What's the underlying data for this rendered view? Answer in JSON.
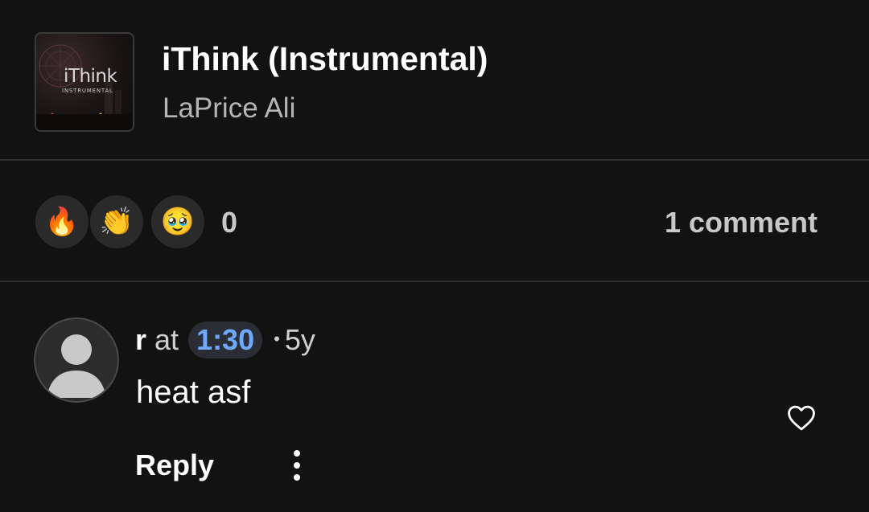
{
  "track": {
    "title": "iThink (Instrumental)",
    "artist": "LaPrice Ali",
    "artwork": {
      "title": "iThink",
      "subtitle": "INSTRUMENTAL"
    }
  },
  "reactions": {
    "items": [
      {
        "name": "fire",
        "emoji": "🔥"
      },
      {
        "name": "clap",
        "emoji": "👏"
      },
      {
        "name": "pleading",
        "emoji": "🥹"
      }
    ],
    "count": "0"
  },
  "comments": {
    "count_label": "1 comment",
    "items": [
      {
        "user": "r",
        "at_label": "at",
        "timestamp": "1:30",
        "separator": "•",
        "age": "5y",
        "text": "heat asf",
        "reply_label": "Reply"
      }
    ]
  },
  "colors": {
    "background": "#121212",
    "timestamp_accent": "#6fa8ff",
    "muted_text": "#b5b5b5"
  },
  "icons": {
    "like": "heart-outline-icon",
    "more": "vertical-ellipsis-icon",
    "avatar": "default-user-icon"
  }
}
